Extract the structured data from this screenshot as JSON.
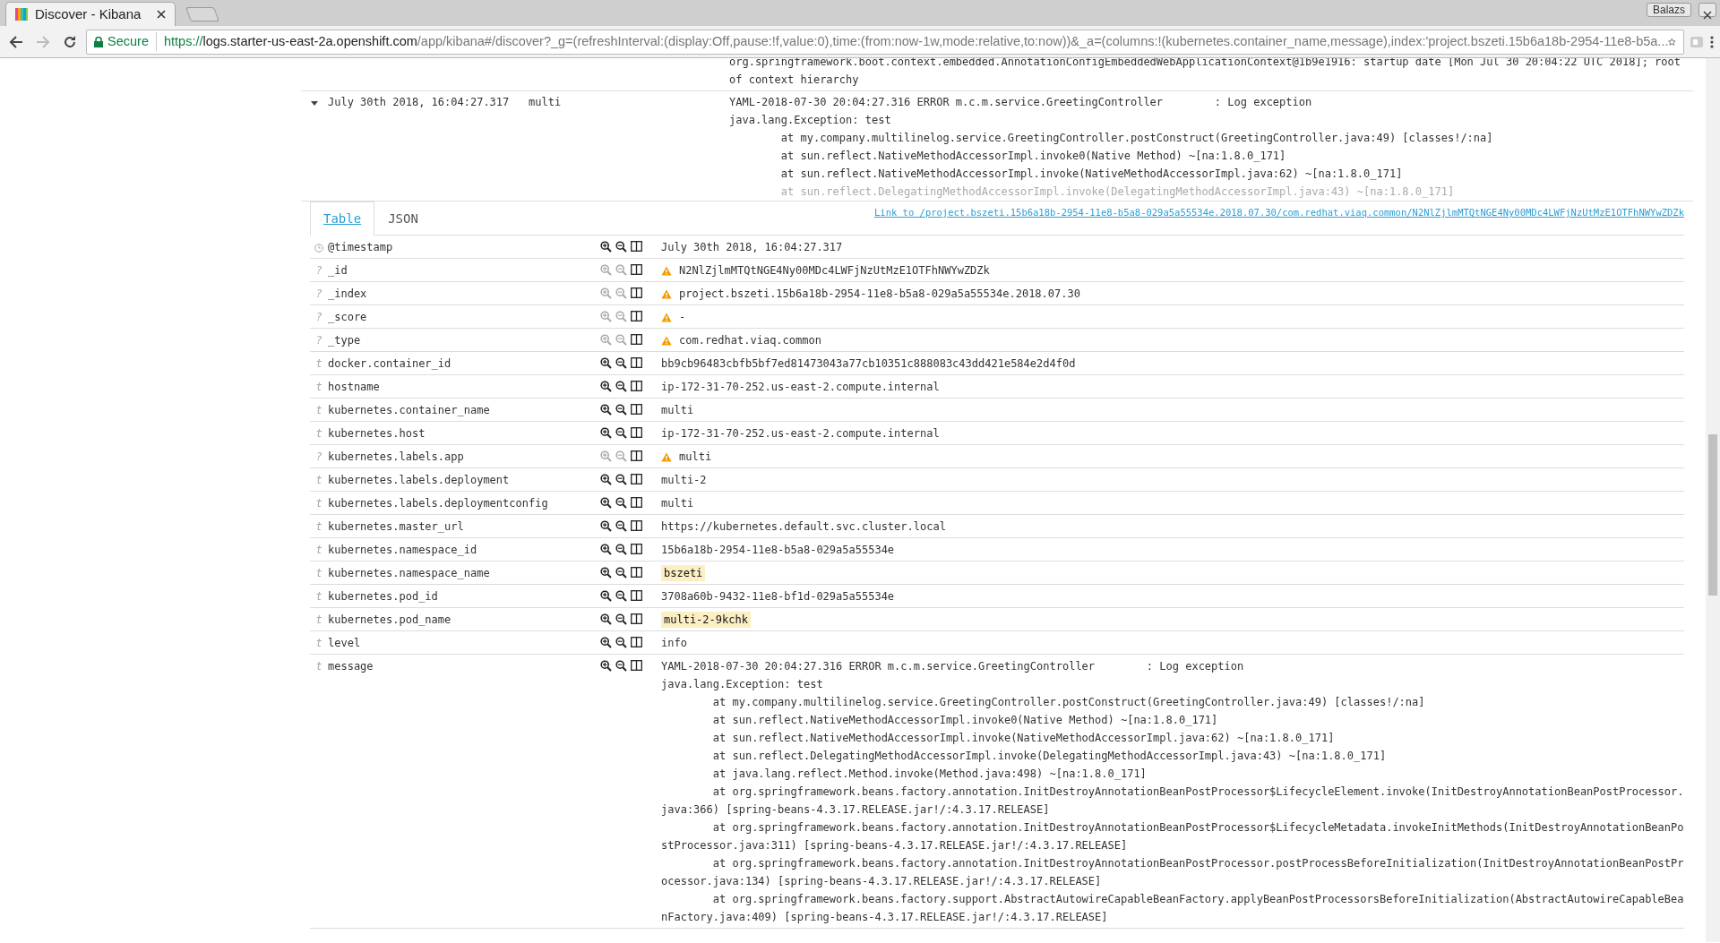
{
  "browser": {
    "tab_title": "Discover - Kibana",
    "address": {
      "secure_label": "Secure",
      "scheme": "https://",
      "host": "logs.starter-us-east-2a.openshift.com",
      "rest": "/app/kibana#/discover?_g=(refreshInterval:(display:Off,pause:!f,value:0),time:(from:now-1w,mode:relative,to:now))&_a=(columns:!(kubernetes.container_name,message),index:'project.bszeti.15b6a18b-2954-11e8-b5a..."
    },
    "profile": "Balazs"
  },
  "previous_row": {
    "message_lines": [
      "org.springframework.boot.context.embedded.AnnotationConfigEmbeddedWebApplicationContext@1b9e1916: startup date [Mon Jul 30 20:04:22 UTC 2018]; root",
      "of context hierarchy"
    ]
  },
  "document": {
    "expanded": true,
    "time": "July 30th 2018, 16:04:27.317",
    "container_name": "multi",
    "message_lines": [
      "YAML-2018-07-30 20:04:27.316 ERROR m.c.m.service.GreetingController        : Log exception",
      "java.lang.Exception: test",
      "\tat my.company.multilinelog.service.GreetingController.postConstruct(GreetingController.java:49) [classes!/:na]",
      "\tat sun.reflect.NativeMethodAccessorImpl.invoke0(Native Method) ~[na:1.8.0_171]",
      "\tat sun.reflect.NativeMethodAccessorImpl.invoke(NativeMethodAccessorImpl.java:62) ~[na:1.8.0_171]",
      "\tat sun.reflect.DelegatingMethodAccessorImpl.invoke(DelegatingMethodAccessorImpl.java:43) ~[na:1.8.0_171]"
    ]
  },
  "detail_tabs": [
    {
      "label": "Table",
      "selected": true
    },
    {
      "label": "JSON",
      "selected": false
    }
  ],
  "document_link": "Link to /project.bszeti.15b6a18b-2954-11e8-b5a8-029a5a55534e.2018.07.30/com.redhat.viaq.common/N2NlZjlmMTQtNGE4Ny00MDc4LWFjNzUtMzE1OTFhNWYwZDZk",
  "fields": [
    {
      "kind": "date",
      "name": "@timestamp",
      "filterable": true,
      "warning": false,
      "highlighted": false,
      "value": "July 30th 2018, 16:04:27.317"
    },
    {
      "kind": "text",
      "type_label": "?",
      "name": "_id",
      "filterable": false,
      "warning": true,
      "highlighted": false,
      "value": "N2NlZjlmMTQtNGE4Ny00MDc4LWFjNzUtMzE1OTFhNWYwZDZk"
    },
    {
      "kind": "text",
      "type_label": "?",
      "name": "_index",
      "filterable": false,
      "warning": true,
      "highlighted": false,
      "value": "project.bszeti.15b6a18b-2954-11e8-b5a8-029a5a55534e.2018.07.30"
    },
    {
      "kind": "text",
      "type_label": "?",
      "name": "_score",
      "filterable": false,
      "warning": true,
      "highlighted": false,
      "value": "-"
    },
    {
      "kind": "text",
      "type_label": "?",
      "name": "_type",
      "filterable": false,
      "warning": true,
      "highlighted": false,
      "value": "com.redhat.viaq.common"
    },
    {
      "kind": "text",
      "type_label": "t",
      "name": "docker.container_id",
      "filterable": true,
      "warning": false,
      "highlighted": false,
      "value": "bb9cb96483cbfb5bf7ed81473043a77cb10351c888083c43dd421e584e2d4f0d"
    },
    {
      "kind": "text",
      "type_label": "t",
      "name": "hostname",
      "filterable": true,
      "warning": false,
      "highlighted": false,
      "value": "ip-172-31-70-252.us-east-2.compute.internal"
    },
    {
      "kind": "text",
      "type_label": "t",
      "name": "kubernetes.container_name",
      "filterable": true,
      "warning": false,
      "highlighted": false,
      "value": "multi"
    },
    {
      "kind": "text",
      "type_label": "t",
      "name": "kubernetes.host",
      "filterable": true,
      "warning": false,
      "highlighted": false,
      "value": "ip-172-31-70-252.us-east-2.compute.internal"
    },
    {
      "kind": "text",
      "type_label": "?",
      "name": "kubernetes.labels.app",
      "filterable": false,
      "warning": true,
      "highlighted": false,
      "value": "multi"
    },
    {
      "kind": "text",
      "type_label": "t",
      "name": "kubernetes.labels.deployment",
      "filterable": true,
      "warning": false,
      "highlighted": false,
      "value": "multi-2"
    },
    {
      "kind": "text",
      "type_label": "t",
      "name": "kubernetes.labels.deploymentconfig",
      "filterable": true,
      "warning": false,
      "highlighted": false,
      "value": "multi"
    },
    {
      "kind": "text",
      "type_label": "t",
      "name": "kubernetes.master_url",
      "filterable": true,
      "warning": false,
      "highlighted": false,
      "value": "https://kubernetes.default.svc.cluster.local"
    },
    {
      "kind": "text",
      "type_label": "t",
      "name": "kubernetes.namespace_id",
      "filterable": true,
      "warning": false,
      "highlighted": false,
      "value": "15b6a18b-2954-11e8-b5a8-029a5a55534e"
    },
    {
      "kind": "text",
      "type_label": "t",
      "name": "kubernetes.namespace_name",
      "filterable": true,
      "warning": false,
      "highlighted": true,
      "value": "bszeti"
    },
    {
      "kind": "text",
      "type_label": "t",
      "name": "kubernetes.pod_id",
      "filterable": true,
      "warning": false,
      "highlighted": false,
      "value": "3708a60b-9432-11e8-bf1d-029a5a55534e"
    },
    {
      "kind": "text",
      "type_label": "t",
      "name": "kubernetes.pod_name",
      "filterable": true,
      "warning": false,
      "highlighted": true,
      "value": "multi-2-9kchk"
    },
    {
      "kind": "text",
      "type_label": "t",
      "name": "level",
      "filterable": true,
      "warning": false,
      "highlighted": false,
      "value": "info"
    },
    {
      "kind": "text",
      "type_label": "t",
      "name": "message",
      "filterable": true,
      "warning": false,
      "highlighted": false,
      "value_lines": [
        "YAML-2018-07-30 20:04:27.316 ERROR m.c.m.service.GreetingController        : Log exception",
        "java.lang.Exception: test",
        "\tat my.company.multilinelog.service.GreetingController.postConstruct(GreetingController.java:49) [classes!/:na]",
        "\tat sun.reflect.NativeMethodAccessorImpl.invoke0(Native Method) ~[na:1.8.0_171]",
        "\tat sun.reflect.NativeMethodAccessorImpl.invoke(NativeMethodAccessorImpl.java:62) ~[na:1.8.0_171]",
        "\tat sun.reflect.DelegatingMethodAccessorImpl.invoke(DelegatingMethodAccessorImpl.java:43) ~[na:1.8.0_171]",
        "\tat java.lang.reflect.Method.invoke(Method.java:498) ~[na:1.8.0_171]",
        "\tat org.springframework.beans.factory.annotation.InitDestroyAnnotationBeanPostProcessor$LifecycleElement.invoke(InitDestroyAnnotationBeanPostProcessor.java:366) [spring-beans-4.3.17.RELEASE.jar!/:4.3.17.RELEASE]",
        "\tat org.springframework.beans.factory.annotation.InitDestroyAnnotationBeanPostProcessor$LifecycleMetadata.invokeInitMethods(InitDestroyAnnotationBeanPostProcessor.java:311) [spring-beans-4.3.17.RELEASE.jar!/:4.3.17.RELEASE]",
        "\tat org.springframework.beans.factory.annotation.InitDestroyAnnotationBeanPostProcessor.postProcessBeforeInitialization(InitDestroyAnnotationBeanPostProcessor.java:134) [spring-beans-4.3.17.RELEASE.jar!/:4.3.17.RELEASE]",
        "\tat org.springframework.beans.factory.support.AbstractAutowireCapableBeanFactory.applyBeanPostProcessorsBeforeInitialization(AbstractAutowireCapableBeanFactory.java:409) [spring-beans-4.3.17.RELEASE.jar!/:4.3.17.RELEASE]"
      ]
    }
  ]
}
